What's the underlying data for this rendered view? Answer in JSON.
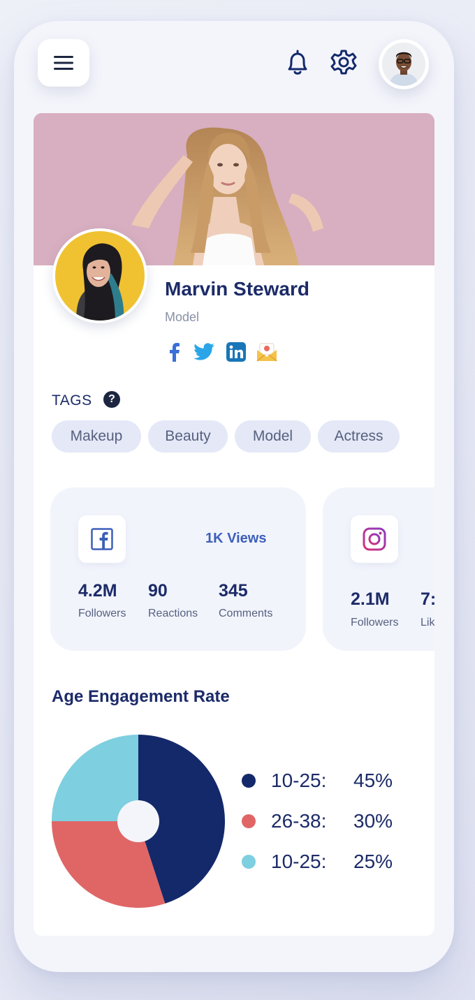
{
  "header": {
    "menu_icon": "hamburger-menu-icon",
    "notification_icon": "bell-icon",
    "settings_icon": "gear-icon",
    "user_avatar": "avatar"
  },
  "profile": {
    "name": "Marvin Steward",
    "role": "Model",
    "social_links": [
      "facebook-icon",
      "twitter-icon",
      "linkedin-icon",
      "email-icon"
    ]
  },
  "tags": {
    "label": "TAGS",
    "help_icon": "?",
    "items": [
      "Makeup",
      "Beauty",
      "Model",
      "Actress"
    ]
  },
  "stats": [
    {
      "platform": "facebook",
      "views": "1K Views",
      "metrics": [
        {
          "value": "4.2M",
          "label": "Followers"
        },
        {
          "value": "90",
          "label": "Reactions"
        },
        {
          "value": "345",
          "label": "Comments"
        }
      ]
    },
    {
      "platform": "instagram",
      "metrics": [
        {
          "value": "2.1M",
          "label": "Followers"
        },
        {
          "value": "7:",
          "label": "Lik"
        }
      ]
    }
  ],
  "engagement": {
    "title": "Age Engagement Rate"
  },
  "chart_data": {
    "type": "pie",
    "categories": [
      "10-25:",
      "26-38:",
      "10-25:"
    ],
    "values": [
      45,
      30,
      25
    ],
    "labels": [
      "45%",
      "30%",
      "25%"
    ],
    "colors": [
      "#13296a",
      "#e06666",
      "#7ecfdf"
    ],
    "title": "Age Engagement Rate"
  },
  "colors": {
    "brand_navy": "#1c2b68",
    "accent_blue": "#3c5fb8",
    "chip_bg": "#e4e8f7"
  }
}
